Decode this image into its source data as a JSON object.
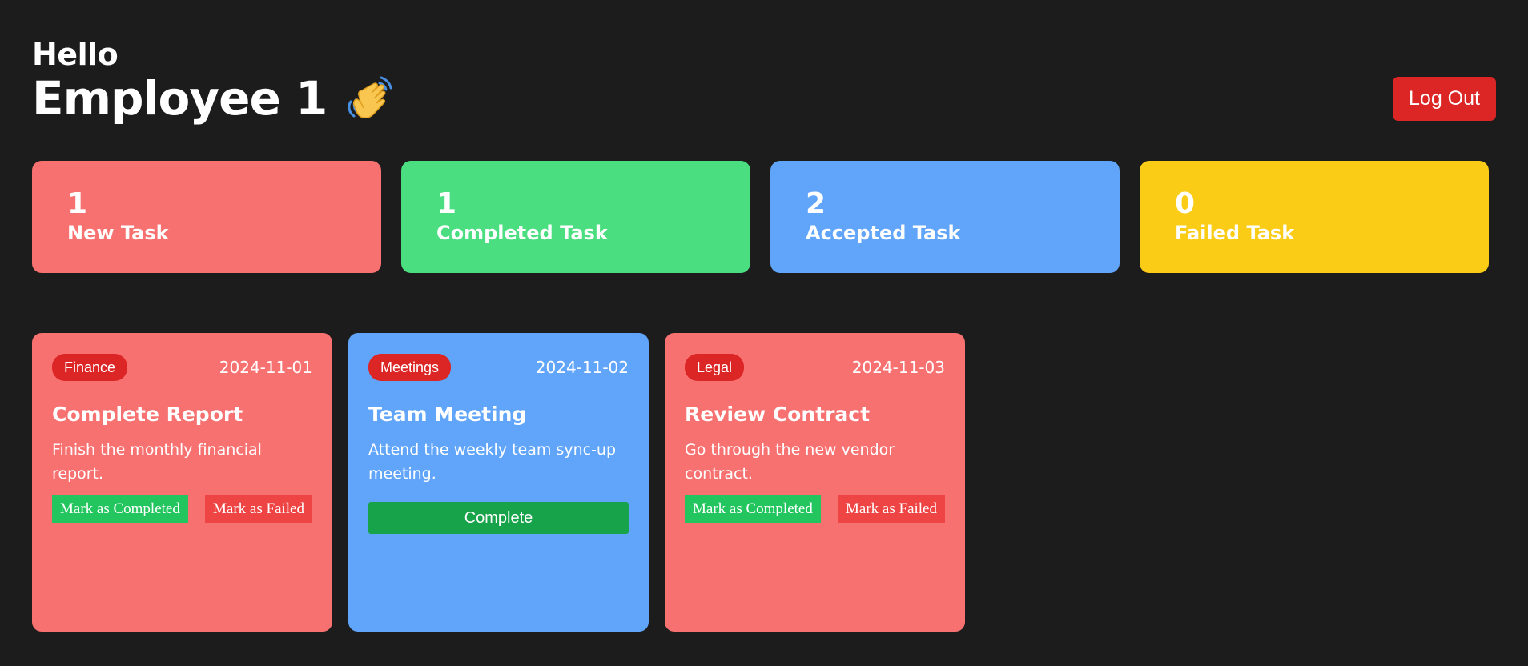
{
  "header": {
    "greeting": "Hello",
    "name": "Employee 1",
    "wave_emoji": "👋",
    "logout_label": "Log Out"
  },
  "stats": [
    {
      "count": "1",
      "label": "New Task",
      "color": "#f87171"
    },
    {
      "count": "1",
      "label": "Completed Task",
      "color": "#4ade80"
    },
    {
      "count": "2",
      "label": "Accepted Task",
      "color": "#60a5fa"
    },
    {
      "count": "0",
      "label": "Failed Task",
      "color": "#facc15"
    }
  ],
  "tasks": [
    {
      "category": "Finance",
      "date": "2024-11-01",
      "title": "Complete Report",
      "description": "Finish the monthly financial report.",
      "color": "#f87171",
      "complete_label": "Mark as Completed",
      "fail_label": "Mark as Failed"
    },
    {
      "category": "Meetings",
      "date": "2024-11-02",
      "title": "Team Meeting",
      "description": "Attend the weekly team sync-up meeting.",
      "color": "#60a5fa",
      "action_label": "Complete"
    },
    {
      "category": "Legal",
      "date": "2024-11-03",
      "title": "Review Contract",
      "description": "Go through the new vendor contract.",
      "color": "#f87171",
      "complete_label": "Mark as Completed",
      "fail_label": "Mark as Failed"
    }
  ]
}
